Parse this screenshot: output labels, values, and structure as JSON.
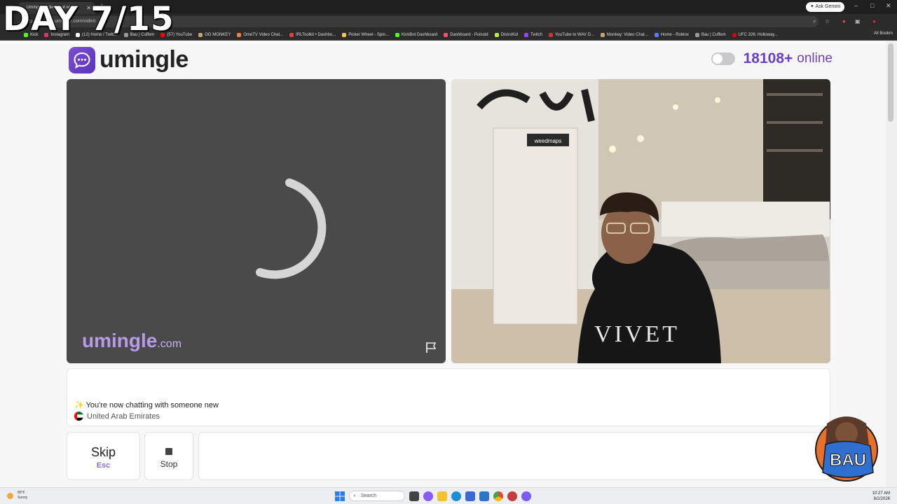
{
  "overlay": {
    "text": "DAY 7/15"
  },
  "browser": {
    "tab_title": "Umingle: Video Chat with S",
    "url": "umingle.com/video",
    "ask_gemini": "Ask Gemini",
    "bookmarks": [
      {
        "label": "Kick",
        "color": "#53fc18"
      },
      {
        "label": "Instagram",
        "color": "#e1306c"
      },
      {
        "label": "(12) Home / Twitt...",
        "color": "#ffffff"
      },
      {
        "label": "Bau | Cuffem",
        "color": "#999999"
      },
      {
        "label": "(57) YouTube",
        "color": "#ff0000"
      },
      {
        "label": "OG MONKEY",
        "color": "#c9a46a"
      },
      {
        "label": "OmeTV Video Chat...",
        "color": "#f08040"
      },
      {
        "label": "IRLToolkit • Dashbo...",
        "color": "#e04040"
      },
      {
        "label": "Picker Wheel - Spin...",
        "color": "#f2c94c"
      },
      {
        "label": "KickBot Dashboard",
        "color": "#53fc18"
      },
      {
        "label": "Dashboard - Pulsoid",
        "color": "#ff4d6d"
      },
      {
        "label": "DistroKid",
        "color": "#b6f03c"
      },
      {
        "label": "Twitch",
        "color": "#9146ff"
      },
      {
        "label": "YouTube to WAV D...",
        "color": "#cc3333"
      },
      {
        "label": "Monkey: Video Chat...",
        "color": "#c9a46a"
      },
      {
        "label": "Home - Roblox",
        "color": "#5a7bff"
      },
      {
        "label": "Bau | Cuffem",
        "color": "#999999"
      },
      {
        "label": "UFC 326: Holloway...",
        "color": "#d0021b"
      }
    ],
    "all_bookmarks": "All Bookm"
  },
  "header": {
    "logo_text": "umingle",
    "online_count": "18108+",
    "online_label": "online"
  },
  "video": {
    "watermark_main": "umingle",
    "watermark_suffix": ".com",
    "right_poster_sign": "weedmaps"
  },
  "chat": {
    "message": "You're now chatting with someone new",
    "country": "United Arab Emirates"
  },
  "controls": {
    "skip_label": "Skip",
    "skip_key": "Esc",
    "stop_label": "Stop"
  },
  "mascot": {
    "text": "BAU"
  },
  "taskbar": {
    "temp": "80°F",
    "condition": "Sunny",
    "search_placeholder": "Search",
    "time": "10:27 AM",
    "date": "8/2/2026"
  }
}
